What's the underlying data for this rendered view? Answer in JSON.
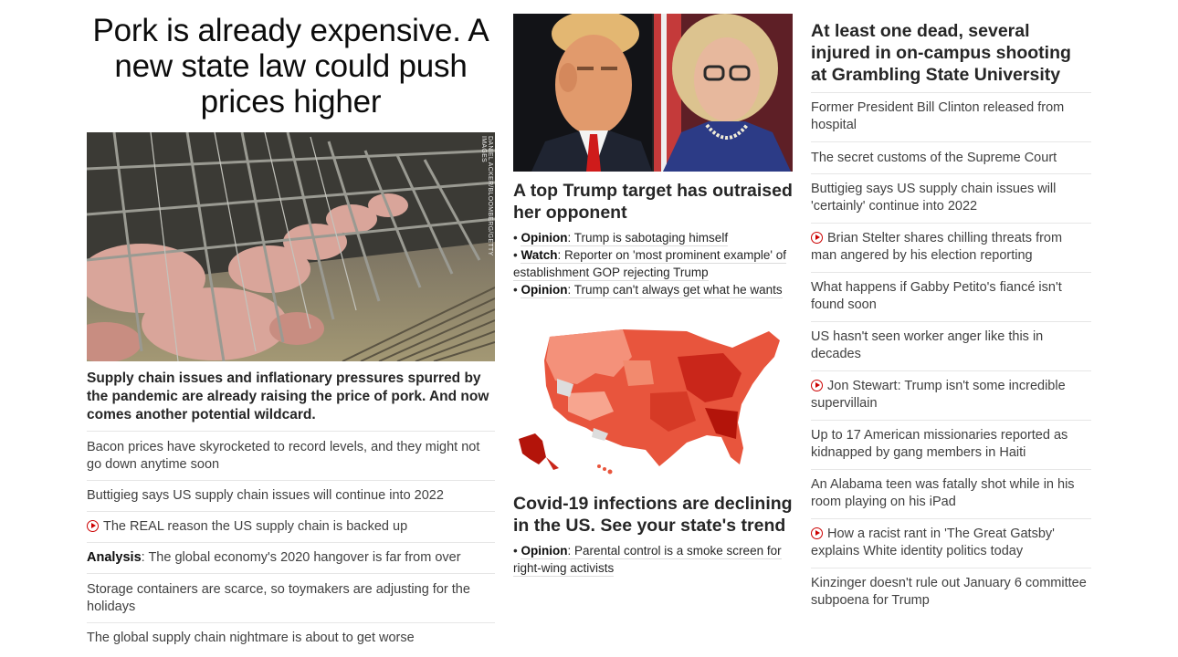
{
  "lead": {
    "headline": "Pork is already expensive. A new state law could push prices higher",
    "photo_credit": "DANIEL ACKER/BLOOMBERG/GETTY IMAGES",
    "description": "Supply chain issues and inflationary pressures spurred by the pandemic are already raising the price of pork. And now comes another potential wildcard.",
    "related": [
      {
        "text": "Bacon prices have skyrocketed to record levels, and they might not go down anytime soon"
      },
      {
        "text": "Buttigieg says US supply chain issues will continue into 2022"
      },
      {
        "video": true,
        "text": "The REAL reason the US supply chain is backed up"
      },
      {
        "prefix": "Analysis",
        "text": ": The global economy's 2020 hangover is far from over"
      },
      {
        "text": "Storage containers are scarce, so toymakers are adjusting for the holidays"
      },
      {
        "text": "The global supply chain nightmare is about to get worse"
      }
    ]
  },
  "middle": {
    "story1": {
      "headline": "A top Trump target has outraised her opponent",
      "bullets": [
        {
          "prefix": "Opinion",
          "text": ": Trump is sabotaging himself"
        },
        {
          "prefix": "Watch",
          "text": ": Reporter on 'most prominent example' of establishment GOP rejecting Trump"
        },
        {
          "prefix": "Opinion",
          "text": ": Trump can't always get what he wants"
        }
      ]
    },
    "story2": {
      "headline": "Covid-19 infections are declining in the US. See your state's trend",
      "bullets": [
        {
          "prefix": "Opinion",
          "text": ": Parental control is a smoke screen for right-wing activists"
        }
      ]
    }
  },
  "right": {
    "headline": "At least one dead, several injured in on-campus shooting at Grambling State University",
    "items": [
      {
        "text": "Former President Bill Clinton released from hospital"
      },
      {
        "text": "The secret customs of the Supreme Court"
      },
      {
        "text": "Buttigieg says US supply chain issues will 'certainly' continue into 2022"
      },
      {
        "video": true,
        "text": "Brian Stelter shares chilling threats from man angered by his election reporting"
      },
      {
        "text": "What happens if Gabby Petito's fiancé isn't found soon"
      },
      {
        "text": "US hasn't seen worker anger like this in decades"
      },
      {
        "video": true,
        "text": "Jon Stewart: Trump isn't some incredible supervillain"
      },
      {
        "text": "Up to 17 American missionaries reported as kidnapped by gang members in Haiti"
      },
      {
        "text": "An Alabama teen was fatally shot while in his room playing on his iPad"
      },
      {
        "video": true,
        "text": "How a racist rant in 'The Great Gatsby' explains White identity politics today"
      },
      {
        "text": "Kinzinger doesn't rule out January 6 committee subpoena for Trump"
      }
    ]
  },
  "colors": {
    "video_red": "#cc0000",
    "map_dark": "#b3140a",
    "map_light": "#f7a58f",
    "text": "#262626"
  }
}
